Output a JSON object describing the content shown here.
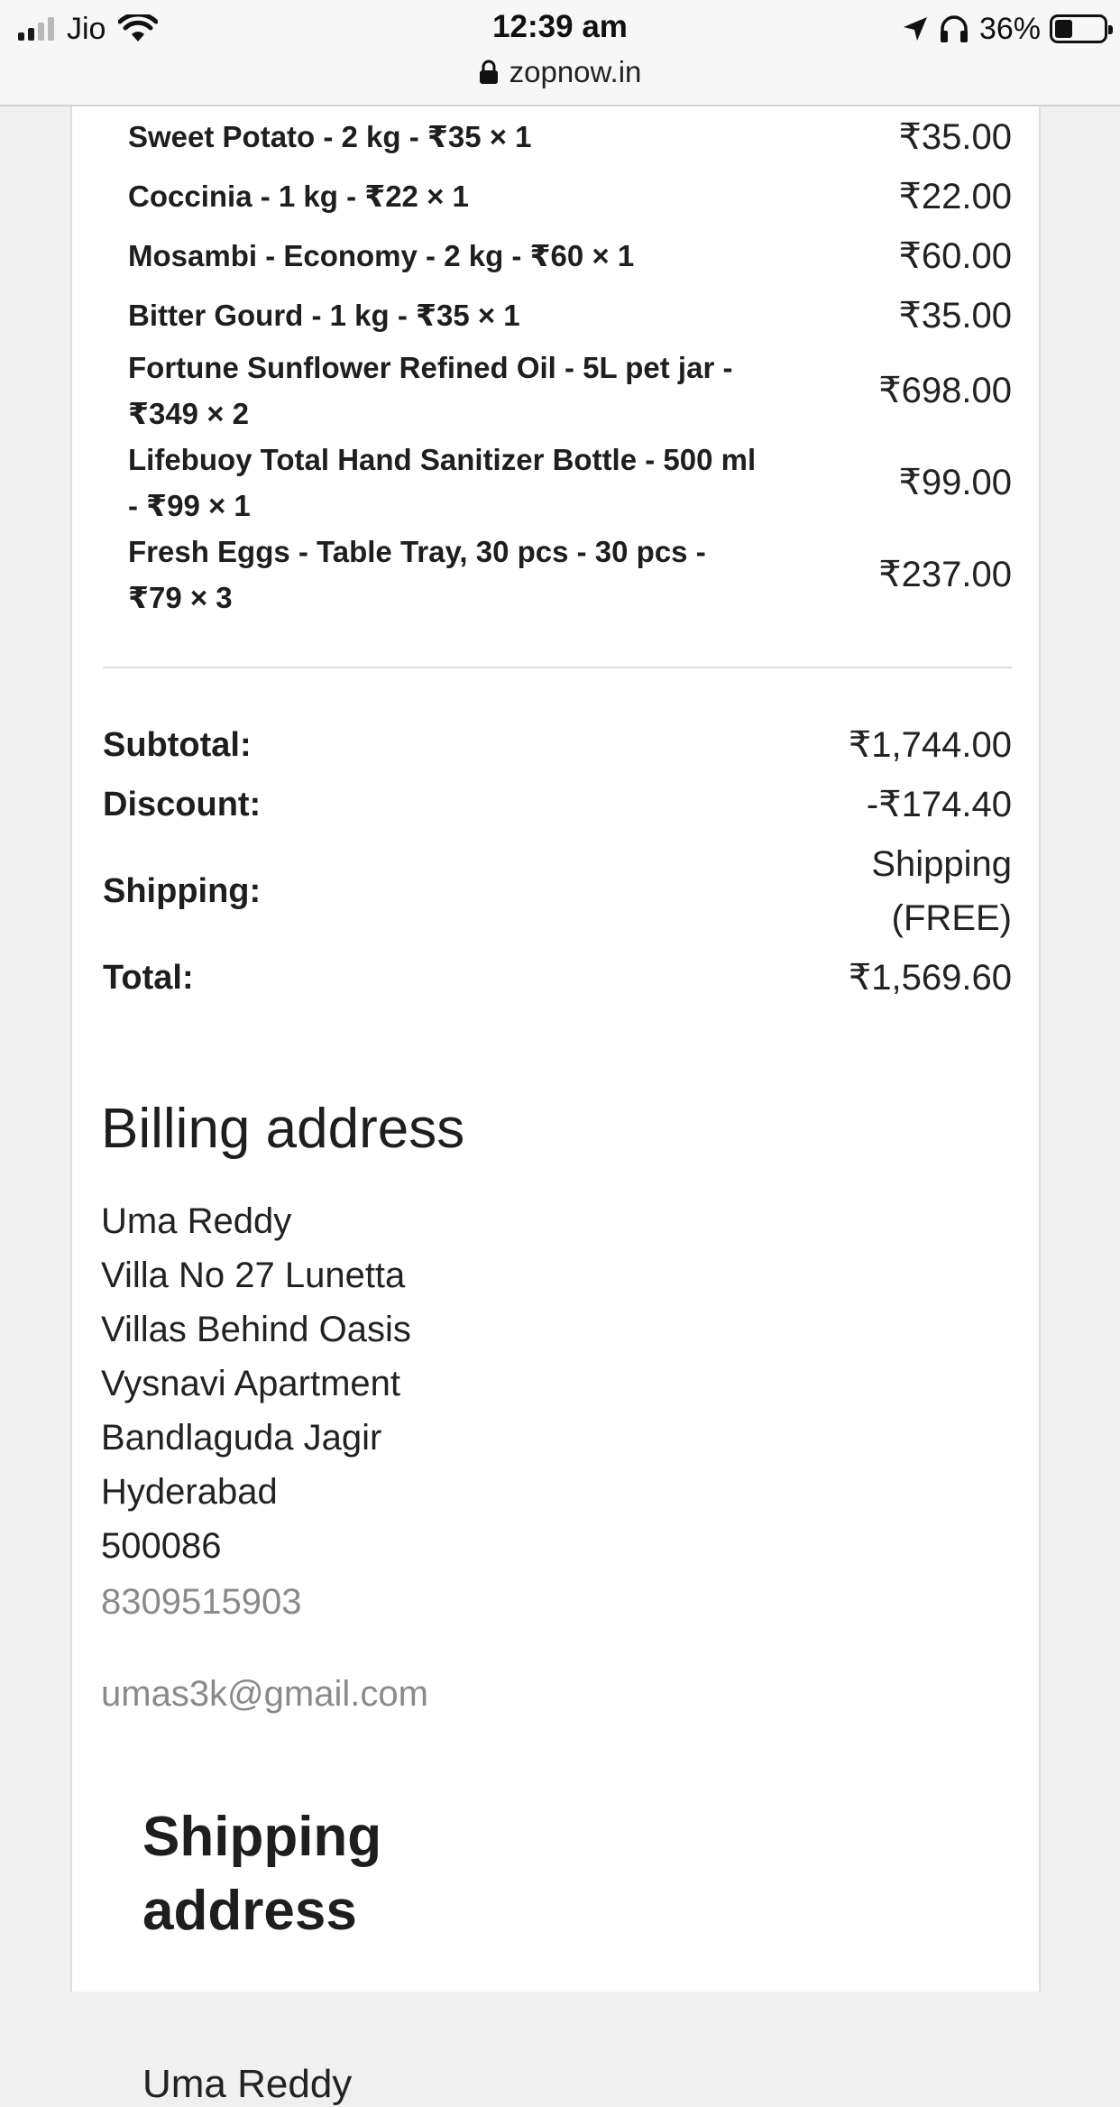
{
  "status_bar": {
    "carrier": "Jio",
    "time": "12:39 am",
    "battery_percent": "36%",
    "battery_level": 0.36,
    "url": "zopnow.in",
    "icons": [
      "signal-icon",
      "wifi-icon",
      "location-arrow-icon",
      "headphones-icon",
      "battery-icon",
      "lock-icon"
    ]
  },
  "order_items": [
    {
      "name": "Sweet Potato - 2 kg - ₹35 × 1",
      "price": "₹35.00"
    },
    {
      "name": "Coccinia - 1 kg - ₹22 × 1",
      "price": "₹22.00"
    },
    {
      "name": "Mosambi - Economy - 2 kg - ₹60 × 1",
      "price": "₹60.00"
    },
    {
      "name": "Bitter Gourd - 1 kg - ₹35 × 1",
      "price": "₹35.00"
    },
    {
      "name": "Fortune Sunflower Refined Oil - 5L pet jar - ₹349 × 2",
      "price": "₹698.00"
    },
    {
      "name": "Lifebuoy Total Hand Sanitizer Bottle - 500 ml - ₹99 × 1",
      "price": "₹99.00"
    },
    {
      "name": "Fresh Eggs - Table Tray, 30 pcs - 30 pcs - ₹79 × 3",
      "price": "₹237.00"
    }
  ],
  "totals": {
    "subtotal_label": "Subtotal:",
    "subtotal": "₹1,744.00",
    "discount_label": "Discount:",
    "discount": "-₹174.40",
    "shipping_label": "Shipping:",
    "shipping": "Shipping (FREE)",
    "total_label": "Total:",
    "total": "₹1,569.60"
  },
  "billing": {
    "title": "Billing address",
    "name": "Uma Reddy",
    "line1": "Villa No 27 Lunetta",
    "line2": "Villas Behind Oasis",
    "line3": "Vysnavi Apartment",
    "line4": "Bandlaguda Jagir",
    "city": "Hyderabad",
    "pin": "500086",
    "phone": "8309515903",
    "email": "umas3k@gmail.com"
  },
  "shipping_address": {
    "title": "Shipping address",
    "name_partial": "Uma Reddy"
  }
}
